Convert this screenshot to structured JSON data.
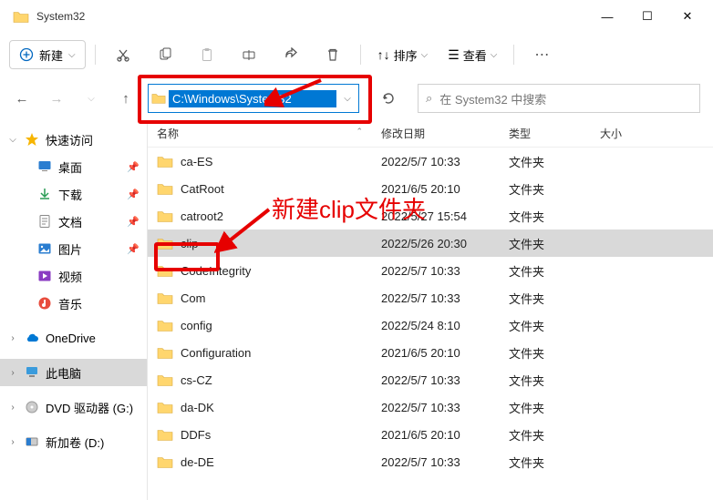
{
  "title": "System32",
  "toolbar": {
    "new_label": "新建",
    "sort_label": "排序",
    "view_label": "查看"
  },
  "address": {
    "path": "C:\\Windows\\System32"
  },
  "search": {
    "placeholder": "在 System32 中搜索"
  },
  "sidebar": {
    "quick_access": "快速访问",
    "desktop": "桌面",
    "downloads": "下载",
    "documents": "文档",
    "pictures": "图片",
    "videos": "视频",
    "music": "音乐",
    "onedrive": "OneDrive",
    "this_pc": "此电脑",
    "dvd": "DVD 驱动器 (G:)",
    "new_volume": "新加卷 (D:)"
  },
  "columns": {
    "name": "名称",
    "modified": "修改日期",
    "type": "类型",
    "size": "大小"
  },
  "folder_type": "文件夹",
  "files": [
    {
      "name": "ca-ES",
      "date": "2022/5/7 10:33"
    },
    {
      "name": "CatRoot",
      "date": "2021/6/5 20:10"
    },
    {
      "name": "catroot2",
      "date": "2022/5/27 15:54"
    },
    {
      "name": "clip",
      "date": "2022/5/26 20:30",
      "selected": true
    },
    {
      "name": "CodeIntegrity",
      "date": "2022/5/7 10:33"
    },
    {
      "name": "Com",
      "date": "2022/5/7 10:33"
    },
    {
      "name": "config",
      "date": "2022/5/24 8:10"
    },
    {
      "name": "Configuration",
      "date": "2021/6/5 20:10"
    },
    {
      "name": "cs-CZ",
      "date": "2022/5/7 10:33"
    },
    {
      "name": "da-DK",
      "date": "2022/5/7 10:33"
    },
    {
      "name": "DDFs",
      "date": "2021/6/5 20:10"
    },
    {
      "name": "de-DE",
      "date": "2022/5/7 10:33"
    }
  ],
  "annotation": {
    "text": "新建clip文件夹"
  }
}
